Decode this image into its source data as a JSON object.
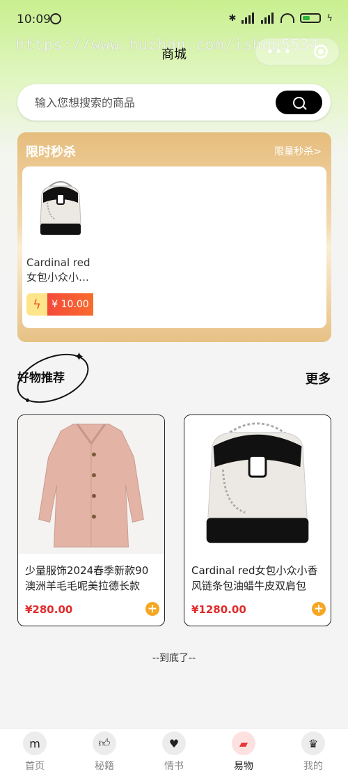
{
  "status_bar": {
    "time": "10:09",
    "net1": "HD",
    "net2": "HD",
    "battery": "4"
  },
  "watermark": "https://www.huzhan.com/ishop5534",
  "header": {
    "title": "商城"
  },
  "search": {
    "placeholder": "输入您想搜索的商品"
  },
  "flash_sale": {
    "title": "限时秒杀",
    "more": "限量秒杀>",
    "product": {
      "name": "Cardinal red\n女包小众小…",
      "price": "¥ 10.00"
    }
  },
  "recommend": {
    "title": "好物推荐",
    "more": "更多",
    "items": [
      {
        "name": "少量服饰2024春季新款90澳洲羊毛毛呢美拉德长款毛…",
        "price": "¥280.00"
      },
      {
        "name": "Cardinal red女包小众小香风链条包油蜡牛皮双肩包",
        "price": "¥1280.00"
      }
    ]
  },
  "end_note": "--到底了--",
  "tabbar": {
    "items": [
      {
        "label": "首页",
        "icon": "home-icon"
      },
      {
        "label": "秘籍",
        "icon": "thumb-icon"
      },
      {
        "label": "情书",
        "icon": "heart-icon"
      },
      {
        "label": "易物",
        "icon": "bag-icon"
      },
      {
        "label": "我的",
        "icon": "crown-icon"
      }
    ],
    "active_index": 3
  },
  "colors": {
    "accent_orange": "#f5a623",
    "price_red": "#e02b2b",
    "flash_gold": "#e6bd7d"
  }
}
